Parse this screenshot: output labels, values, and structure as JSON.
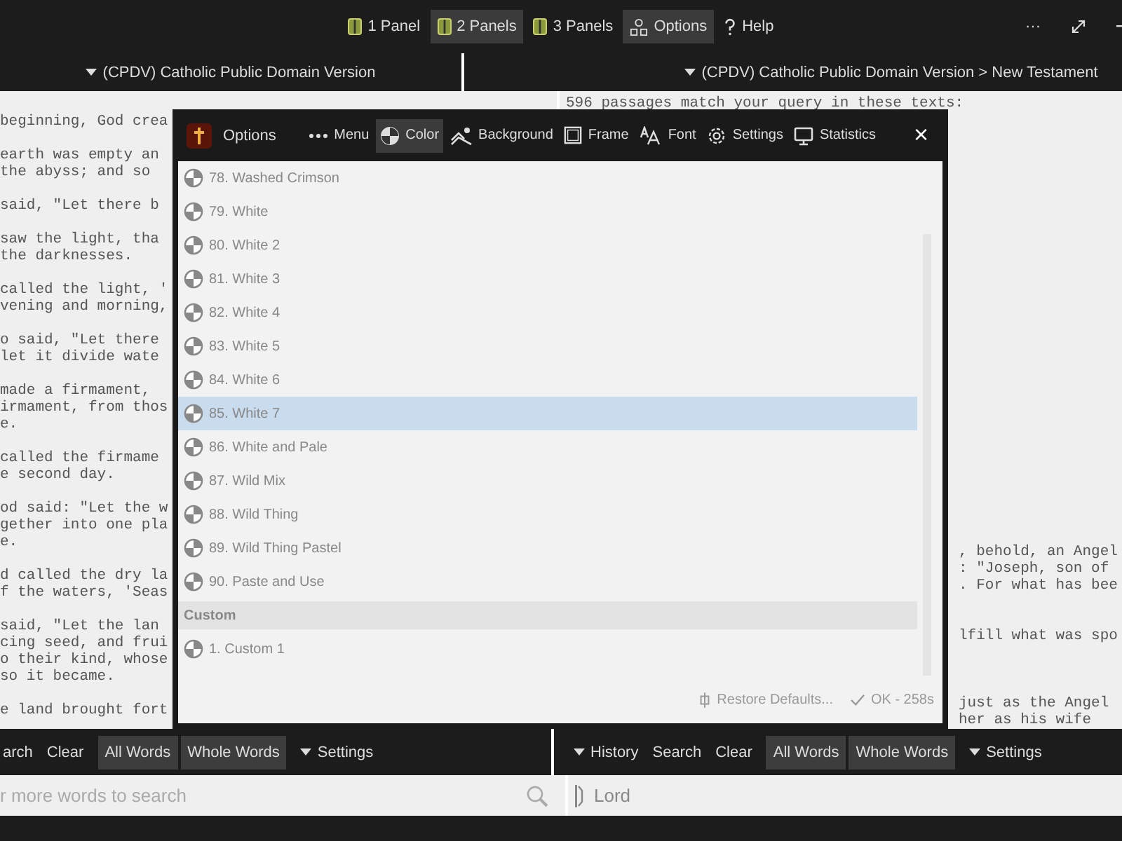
{
  "top_bar": {
    "items": [
      {
        "label": "1 Panel",
        "selected": false
      },
      {
        "label": "2 Panels",
        "selected": true
      },
      {
        "label": "3 Panels",
        "selected": false
      },
      {
        "label": "Options",
        "selected": true
      },
      {
        "label": "Help",
        "selected": false
      }
    ],
    "window_controls": [
      "···"
    ]
  },
  "panels": [
    {
      "title": "(CPDV) Catholic Public Domain Version",
      "paragraphs": [
        [
          "beginning, God crea"
        ],
        [
          "earth was empty an",
          "the abyss; and so"
        ],
        [
          "said, \"Let there b"
        ],
        [
          "saw the light, tha",
          "the darknesses."
        ],
        [
          "called the light, '",
          "vening and morning,"
        ],
        [
          "o said, \"Let there",
          "let it divide wate"
        ],
        [
          "made a firmament,",
          "irmament, from thos",
          "e."
        ],
        [
          "called the firmame",
          "e second day."
        ],
        [
          "od said: \"Let the w",
          "gether into one pla",
          "e."
        ],
        [
          "d called the dry la",
          "f the waters, 'Seas"
        ],
        [
          "said, \"Let the lan",
          "cing seed, and frui",
          "o their kind, whose",
          "so it became."
        ],
        [
          "e land brought fort"
        ]
      ],
      "toolbar": [
        {
          "label": "arch",
          "kind": "link"
        },
        {
          "label": "Clear",
          "kind": "link"
        },
        {
          "label": "All Words",
          "kind": "toggle"
        },
        {
          "label": "Whole Words",
          "kind": "toggle"
        },
        {
          "label": "Settings",
          "kind": "menu"
        }
      ],
      "search": {
        "placeholder": "r more words to search"
      }
    },
    {
      "title": "(CPDV) Catholic Public Domain Version > New Testament",
      "summary": "596 passages match your query in these texts:",
      "paragraphs": [
        [
          ", behold, an Angel",
          ": \"Joseph, son of",
          ". For what has bee"
        ],
        [
          "lfill what was spo"
        ],
        [
          "just as the Angel",
          "her as his wife"
        ]
      ],
      "toolbar": [
        {
          "label": "History",
          "kind": "menu"
        },
        {
          "label": "Search",
          "kind": "link"
        },
        {
          "label": "Clear",
          "kind": "link"
        },
        {
          "label": "All Words",
          "kind": "toggle"
        },
        {
          "label": "Whole Words",
          "kind": "toggle"
        },
        {
          "label": "Settings",
          "kind": "menu"
        }
      ],
      "search": {
        "value": "Lord"
      }
    }
  ],
  "dialog": {
    "title": "Options",
    "tabs": [
      {
        "label": "Menu",
        "selected": false
      },
      {
        "label": "Color",
        "selected": true
      },
      {
        "label": "Background",
        "selected": false
      },
      {
        "label": "Frame",
        "selected": false
      },
      {
        "label": "Font",
        "selected": false
      },
      {
        "label": "Settings",
        "selected": false
      },
      {
        "label": "Statistics",
        "selected": false
      }
    ],
    "close": "×",
    "list": [
      {
        "kind": "item",
        "label": "78. Washed Crimson",
        "selected": false
      },
      {
        "kind": "item",
        "label": "79. White",
        "selected": false
      },
      {
        "kind": "item",
        "label": "80. White 2",
        "selected": false
      },
      {
        "kind": "item",
        "label": "81. White 3",
        "selected": false
      },
      {
        "kind": "item",
        "label": "82. White 4",
        "selected": false
      },
      {
        "kind": "item",
        "label": "83. White 5",
        "selected": false
      },
      {
        "kind": "item",
        "label": "84. White 6",
        "selected": false
      },
      {
        "kind": "item",
        "label": "85. White 7",
        "selected": true
      },
      {
        "kind": "item",
        "label": "86. White and Pale",
        "selected": false
      },
      {
        "kind": "item",
        "label": "87. Wild Mix",
        "selected": false
      },
      {
        "kind": "item",
        "label": "88. Wild Thing",
        "selected": false
      },
      {
        "kind": "item",
        "label": "89. Wild Thing Pastel",
        "selected": false
      },
      {
        "kind": "item",
        "label": "90. Paste and Use",
        "selected": false
      },
      {
        "kind": "header",
        "label": "Custom"
      },
      {
        "kind": "item",
        "label": "1. Custom 1",
        "selected": false
      }
    ],
    "restore": "Restore Defaults...",
    "ok": "OK - 258s"
  }
}
